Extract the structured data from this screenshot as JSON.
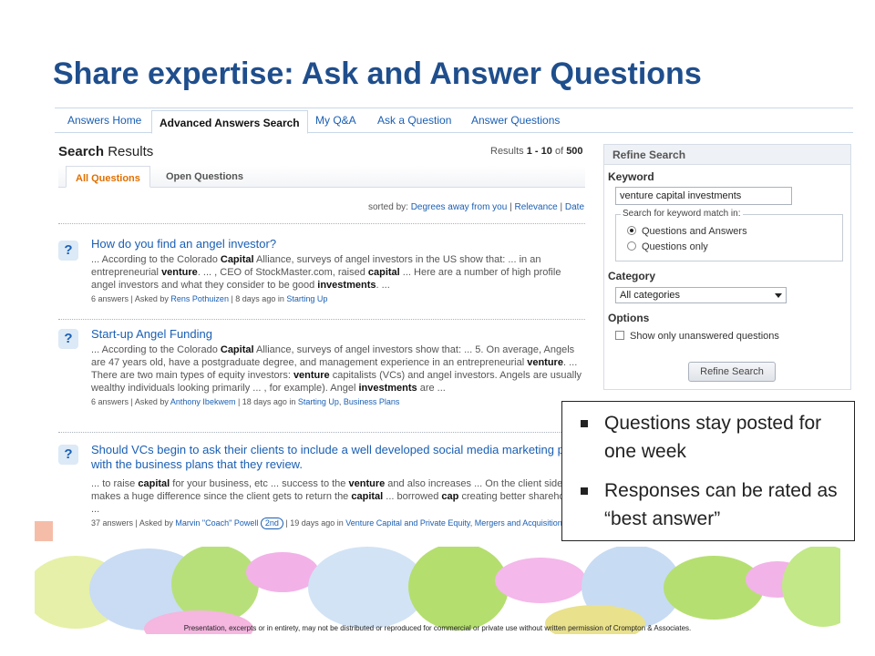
{
  "slide": {
    "title": "Share expertise:  Ask and Answer Questions",
    "footer": "Presentation, excerpts or in entirety, may not be distributed or reproduced for commercial or private use without written permission of Crompton & Associates."
  },
  "tabs": [
    "Answers Home",
    "Advanced Answers Search",
    "My Q&A",
    "Ask a Question",
    "Answer Questions"
  ],
  "active_tab": "Advanced Answers Search",
  "results": {
    "title_bold": "Search",
    "title_rest": " Results",
    "count_prefix": "Results ",
    "count_range": "1 - 10",
    "count_of": " of ",
    "count_total": "500",
    "subtabs": [
      "All Questions",
      "Open Questions"
    ],
    "sort_label": "sorted by: ",
    "sort_options": [
      "Degrees away from you",
      "Relevance",
      "Date"
    ]
  },
  "questions": [
    {
      "icon": "?",
      "title": "How do you find an angel investor?",
      "snippet": [
        "... According to the Colorado ",
        {
          "b": "Capital"
        },
        " Alliance, surveys of angel investors in the US show that: ... in an entrepreneurial ",
        {
          "b": "venture"
        },
        ". ... , CEO of StockMaster.com, raised ",
        {
          "b": "capital"
        },
        " ... Here are a number of high profile angel investors and what they consider to be good ",
        {
          "b": "investments"
        },
        ". ..."
      ],
      "answers": "6 answers",
      "asked_by_label": " | Asked by ",
      "author": "Rens Pothuizen",
      "time": " | 8 days ago in ",
      "categories": [
        "Starting Up"
      ],
      "degree": ""
    },
    {
      "icon": "?",
      "title": "Start-up Angel Funding",
      "snippet": [
        "... According to the Colorado ",
        {
          "b": "Capital"
        },
        " Alliance, surveys of angel investors show that: ... 5. On average, Angels are 47 years old, have a postgraduate degree, and management experience in an entrepreneurial ",
        {
          "b": "venture"
        },
        ". ... There are two main types of equity investors: ",
        {
          "b": "venture"
        },
        " capitalists (VCs) and angel investors. Angels are usually wealthy individuals looking primarily ... , for example). Angel ",
        {
          "b": "investments"
        },
        " are ..."
      ],
      "answers": "6 answers",
      "asked_by_label": " | Asked by ",
      "author": "Anthony Ibekwem",
      "time": " | 18 days ago in ",
      "categories": [
        "Starting Up",
        "Business Plans"
      ],
      "degree": ""
    },
    {
      "icon": "?",
      "title": "Should VCs begin to ask their clients to include a well developed social media marketing plan with the business plans that they review.",
      "snippet": [
        "... to raise ",
        {
          "b": "capital"
        },
        " for your business, etc ... success to the ",
        {
          "b": "venture"
        },
        " and also increases ... On the client side this makes a huge difference since the client gets to return the ",
        {
          "b": "capital"
        },
        " ... borrowed ",
        {
          "b": "cap"
        },
        " creating better shareholder ..."
      ],
      "answers": "37 answers",
      "asked_by_label": " | Asked by ",
      "author": "Marvin \"Coach\" Powell",
      "time": " | 19 days ago in ",
      "categories": [
        "Venture Capital and Private Equity",
        "Mergers and Acquisitions"
      ],
      "degree": "2nd"
    }
  ],
  "refine": {
    "heading": "Refine Search",
    "keyword_label": "Keyword",
    "keyword_value": "venture capital investments",
    "match_legend": "Search for keyword match in:",
    "match_options": [
      {
        "label": "Questions and Answers",
        "selected": true
      },
      {
        "label": "Questions only",
        "selected": false
      }
    ],
    "category_label": "Category",
    "category_value": "All categories",
    "options_label": "Options",
    "unanswered_label": "Show only unanswered questions",
    "unanswered_checked": false,
    "button_label": "Refine Search"
  },
  "callout": {
    "bullets": [
      "Questions stay posted for one week",
      "Responses can be rated as “best answer”"
    ]
  },
  "colors": {
    "title": "#1f4e8c",
    "link": "#1a5fb4",
    "active_subtab": "#e07000"
  }
}
